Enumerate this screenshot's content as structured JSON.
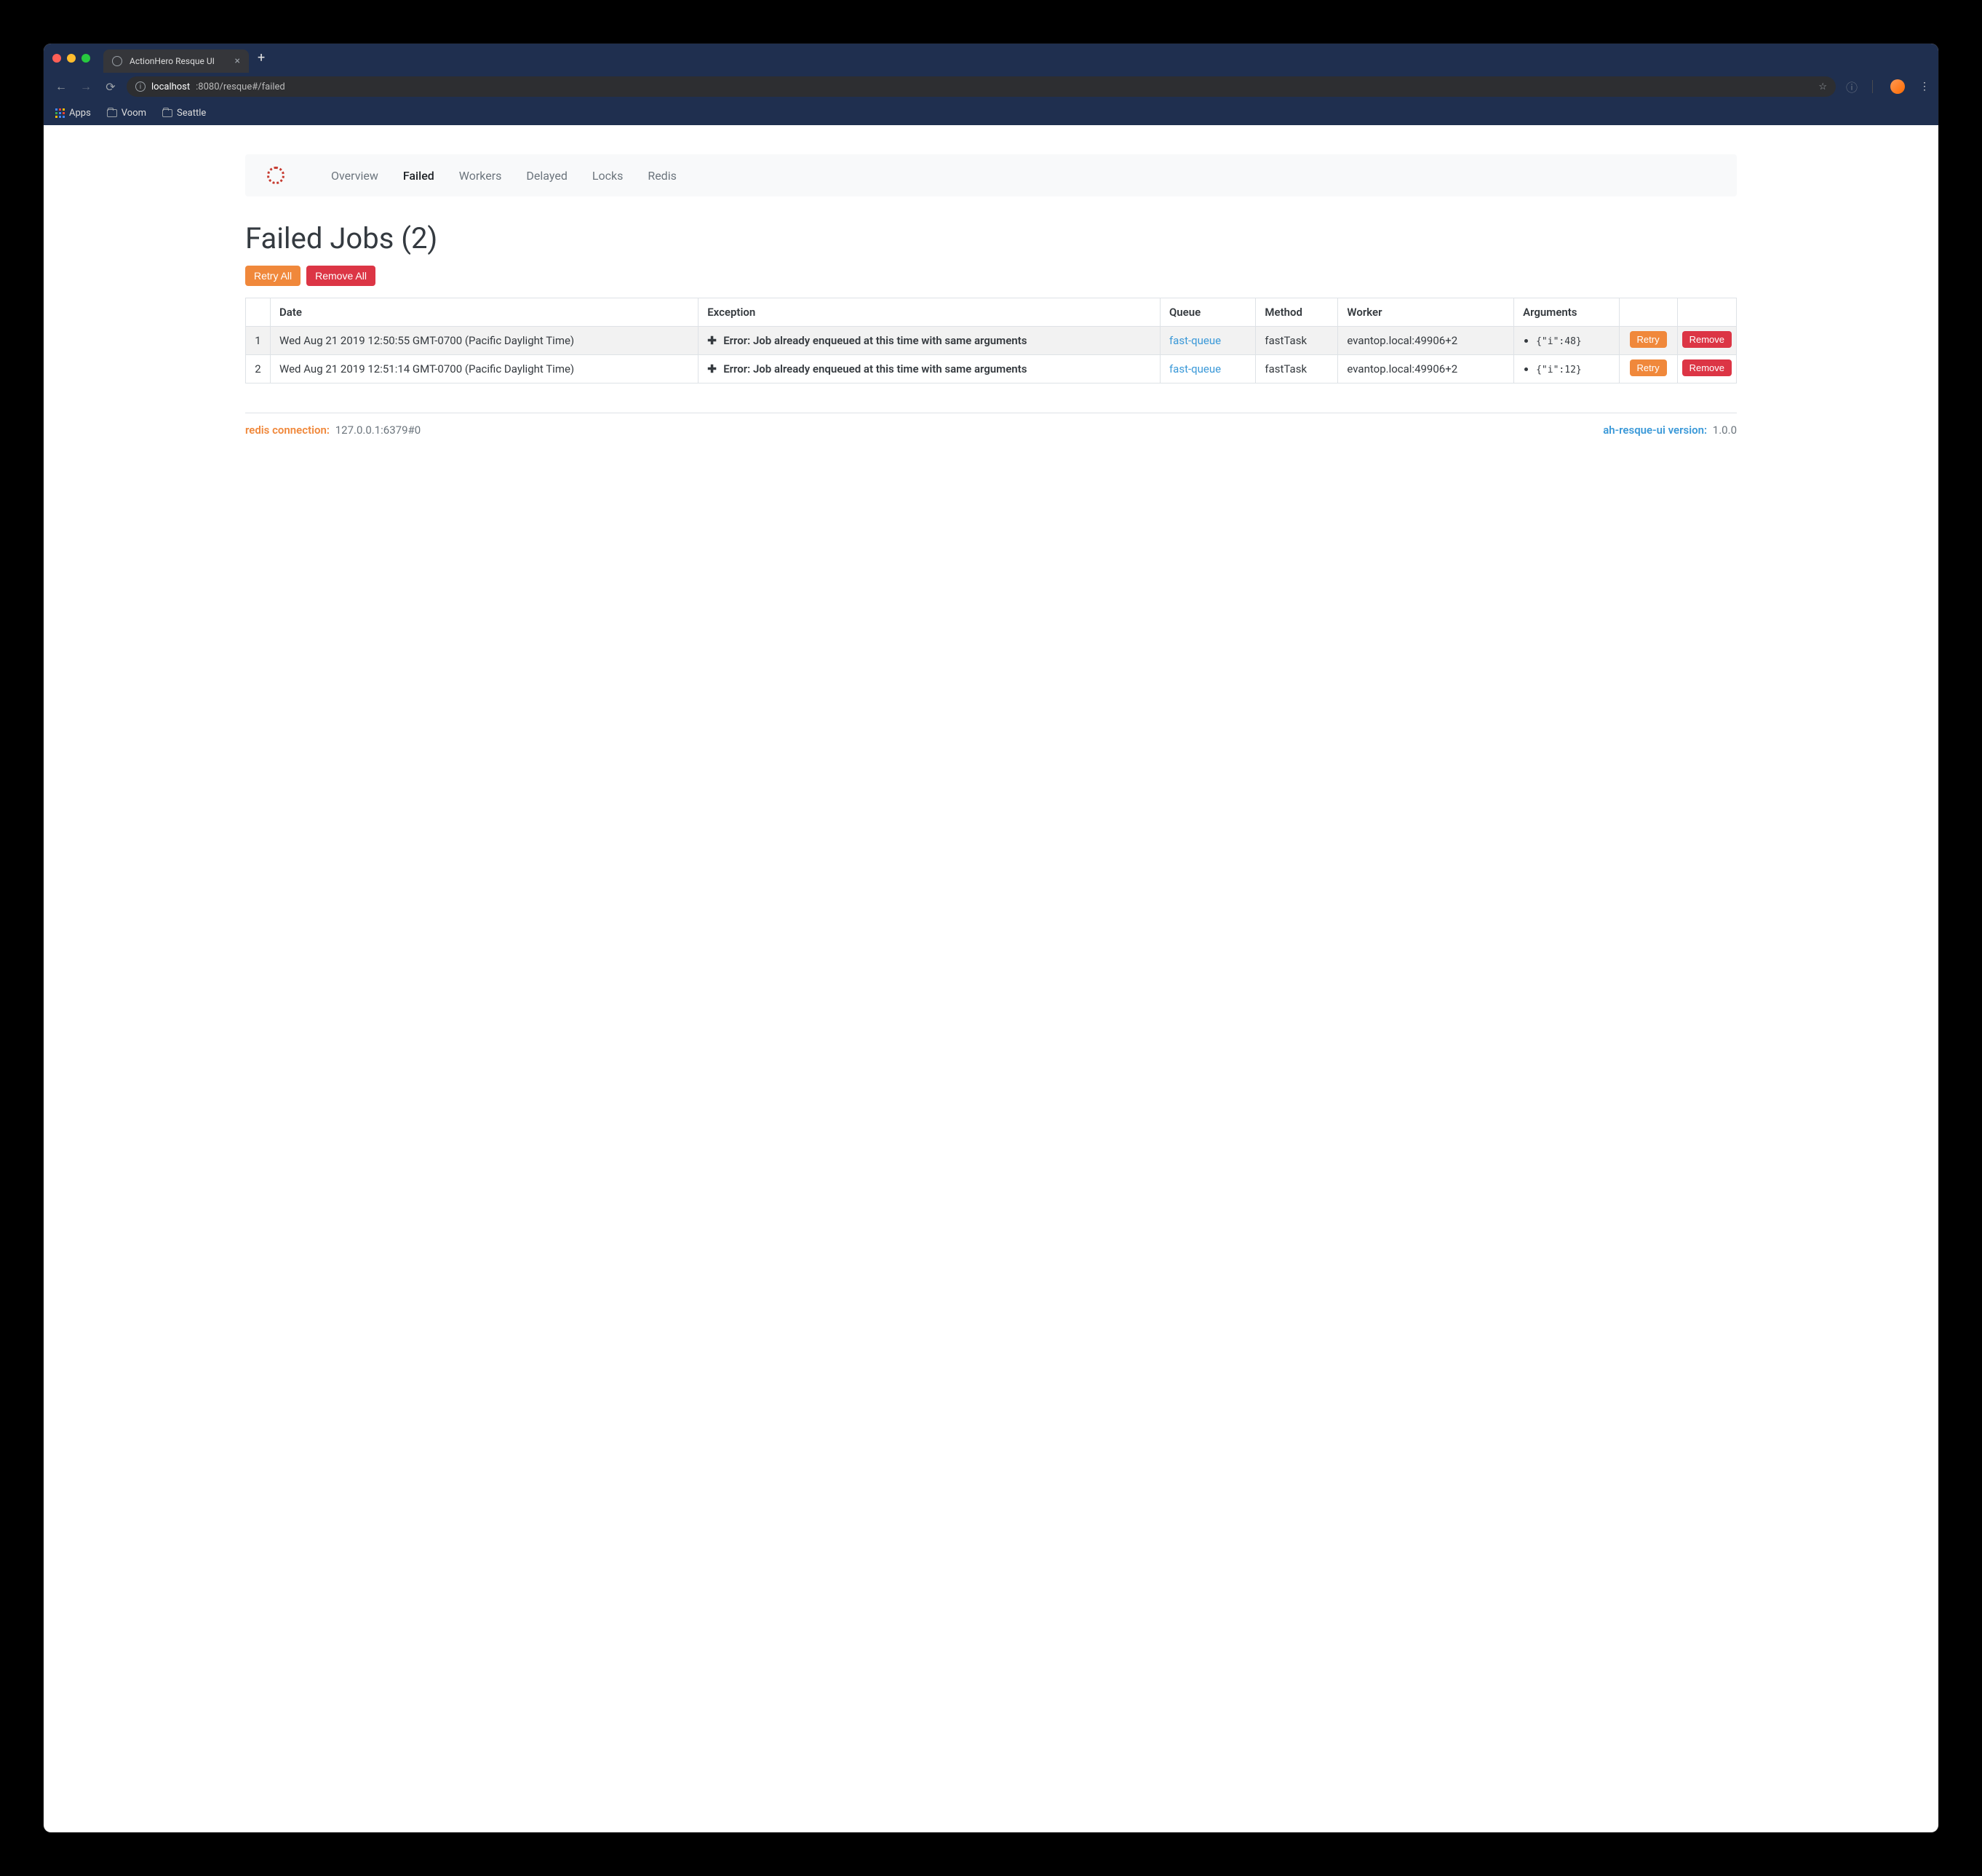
{
  "browser": {
    "tab_title": "ActionHero Resque UI",
    "url_host": "localhost",
    "url_rest": ":8080/resque#/failed",
    "bookmarks": {
      "apps": "Apps",
      "voom": "Voom",
      "seattle": "Seattle"
    }
  },
  "nav": {
    "overview": "Overview",
    "failed": "Failed",
    "workers": "Workers",
    "delayed": "Delayed",
    "locks": "Locks",
    "redis": "Redis"
  },
  "page_title": "Failed Jobs (2)",
  "buttons": {
    "retry_all": "Retry All",
    "remove_all": "Remove All",
    "retry": "Retry",
    "remove": "Remove"
  },
  "table": {
    "headers": {
      "idx": "",
      "date": "Date",
      "exception": "Exception",
      "queue": "Queue",
      "method": "Method",
      "worker": "Worker",
      "arguments": "Arguments"
    },
    "rows": [
      {
        "idx": "1",
        "date": "Wed Aug 21 2019 12:50:55 GMT-0700 (Pacific Daylight Time)",
        "exception": "Error: Job already enqueued at this time with same arguments",
        "queue": "fast-queue",
        "method": "fastTask",
        "worker": "evantop.local:49906+2",
        "arguments": "{\"i\":48}"
      },
      {
        "idx": "2",
        "date": "Wed Aug 21 2019 12:51:14 GMT-0700 (Pacific Daylight Time)",
        "exception": "Error: Job already enqueued at this time with same arguments",
        "queue": "fast-queue",
        "method": "fastTask",
        "worker": "evantop.local:49906+2",
        "arguments": "{\"i\":12}"
      }
    ]
  },
  "footer": {
    "redis_label": "redis connection:",
    "redis_value": "127.0.0.1:6379#0",
    "version_label": "ah-resque-ui version:",
    "version_value": "1.0.0"
  }
}
